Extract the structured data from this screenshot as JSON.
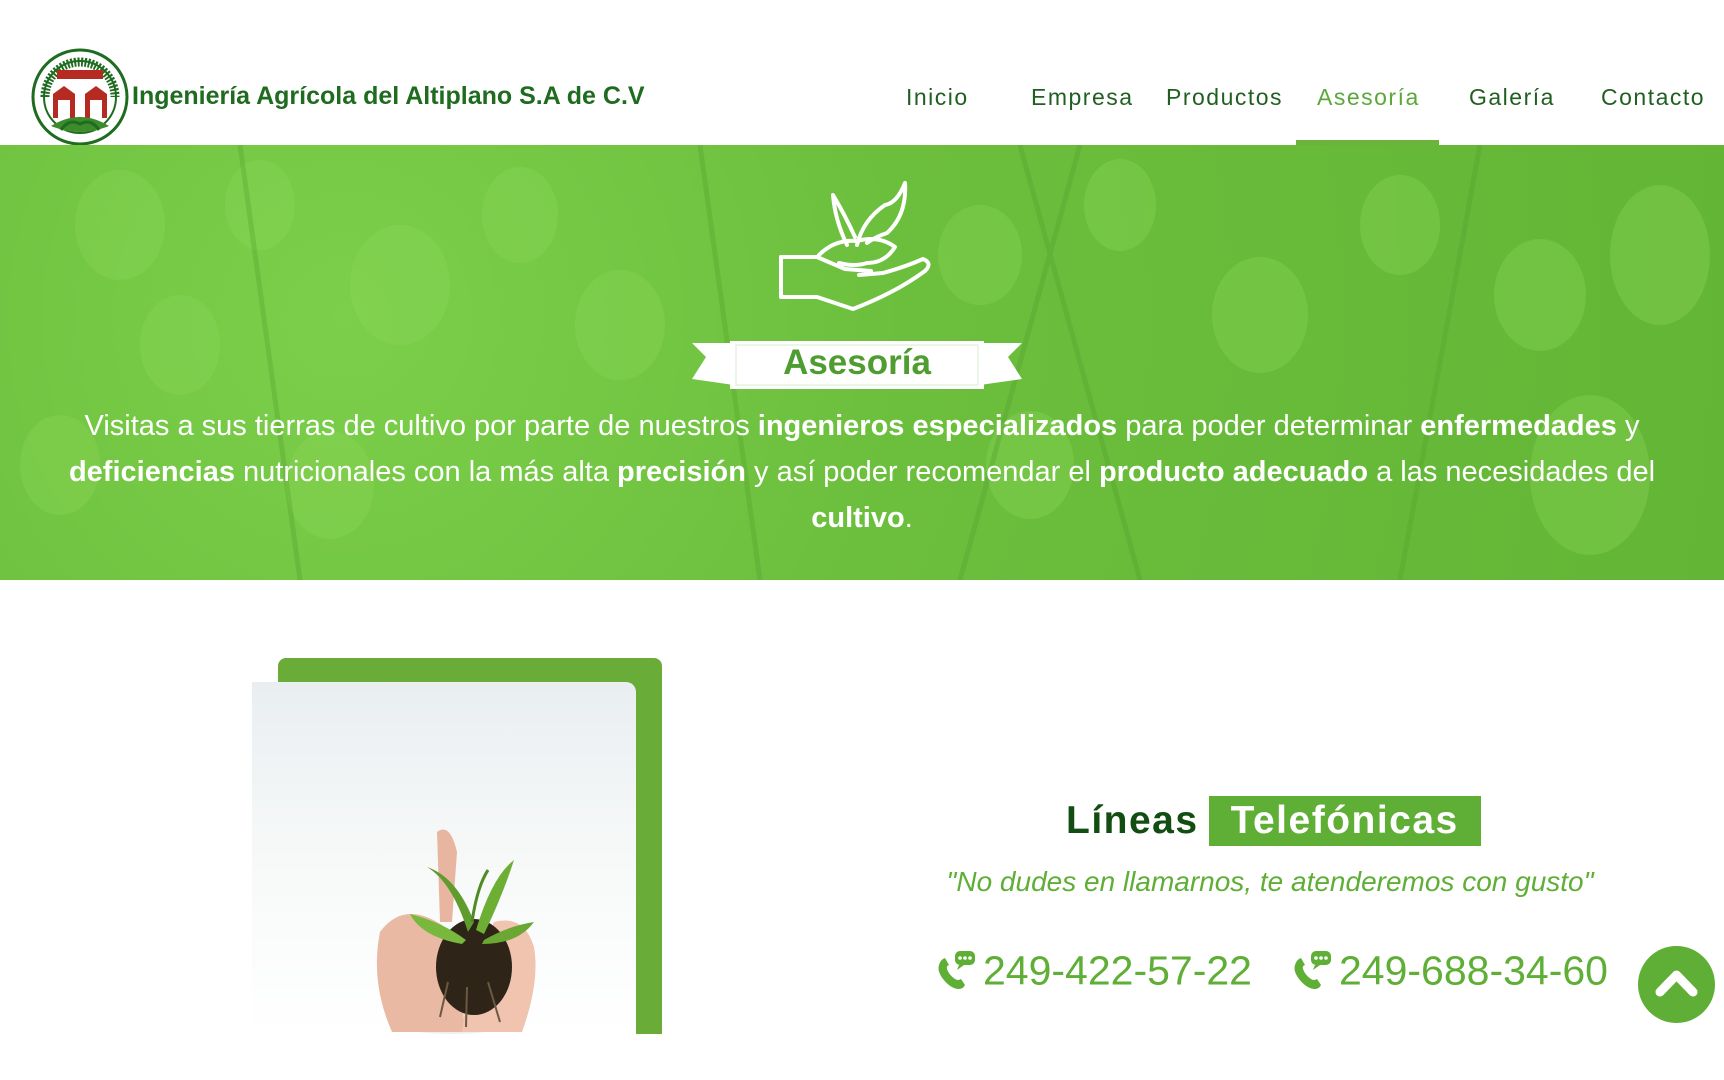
{
  "header": {
    "brand": "Ingeniería Agrícola del Altiplano S.A de C.V",
    "logo_ring_text": "Ingeniería Agrícola del Altiplano S.A de C.V",
    "logo_banner_text": "En armonía con la naturaleza",
    "nav": [
      {
        "label": "Inicio",
        "active": false
      },
      {
        "label": "Empresa",
        "active": false
      },
      {
        "label": "Productos",
        "active": false
      },
      {
        "label": "Asesoría",
        "active": true
      },
      {
        "label": "Galería",
        "active": false
      },
      {
        "label": "Contacto",
        "active": false
      }
    ]
  },
  "hero": {
    "icon": "hand-soil-sprout-icon",
    "title": "Asesoría",
    "paragraph": [
      {
        "text": "Visitas a sus tierras de cultivo por parte de nuestros ",
        "bold": false
      },
      {
        "text": "ingenieros especializados",
        "bold": true
      },
      {
        "text": " para poder determinar ",
        "bold": false
      },
      {
        "text": "enfermedades",
        "bold": true
      },
      {
        "text": " y ",
        "bold": false
      },
      {
        "text": "deficiencias",
        "bold": true
      },
      {
        "text": " nutricionales con la más alta ",
        "bold": false
      },
      {
        "text": "precisión",
        "bold": true
      },
      {
        "text": " y así poder recomendar el ",
        "bold": false
      },
      {
        "text": "producto adecuado",
        "bold": true
      },
      {
        "text": " a las necesidades del ",
        "bold": false
      },
      {
        "text": "cultivo",
        "bold": true
      },
      {
        "text": ".",
        "bold": false
      }
    ]
  },
  "contact": {
    "title_plain": "Líneas",
    "title_highlight": "Telefónicas",
    "tagline": "\"No dudes en llamarnos, te atenderemos con gusto\"",
    "phones": [
      "249-422-57-22",
      "249-688-34-60"
    ],
    "phone_icon": "phone-chat-icon"
  },
  "scroll_top_icon": "chevron-up-icon",
  "colors": {
    "primary_green": "#5fae35",
    "dark_green": "#1f6b1f",
    "hero_green": "#6cbf3d",
    "logo_red": "#b52b22"
  }
}
